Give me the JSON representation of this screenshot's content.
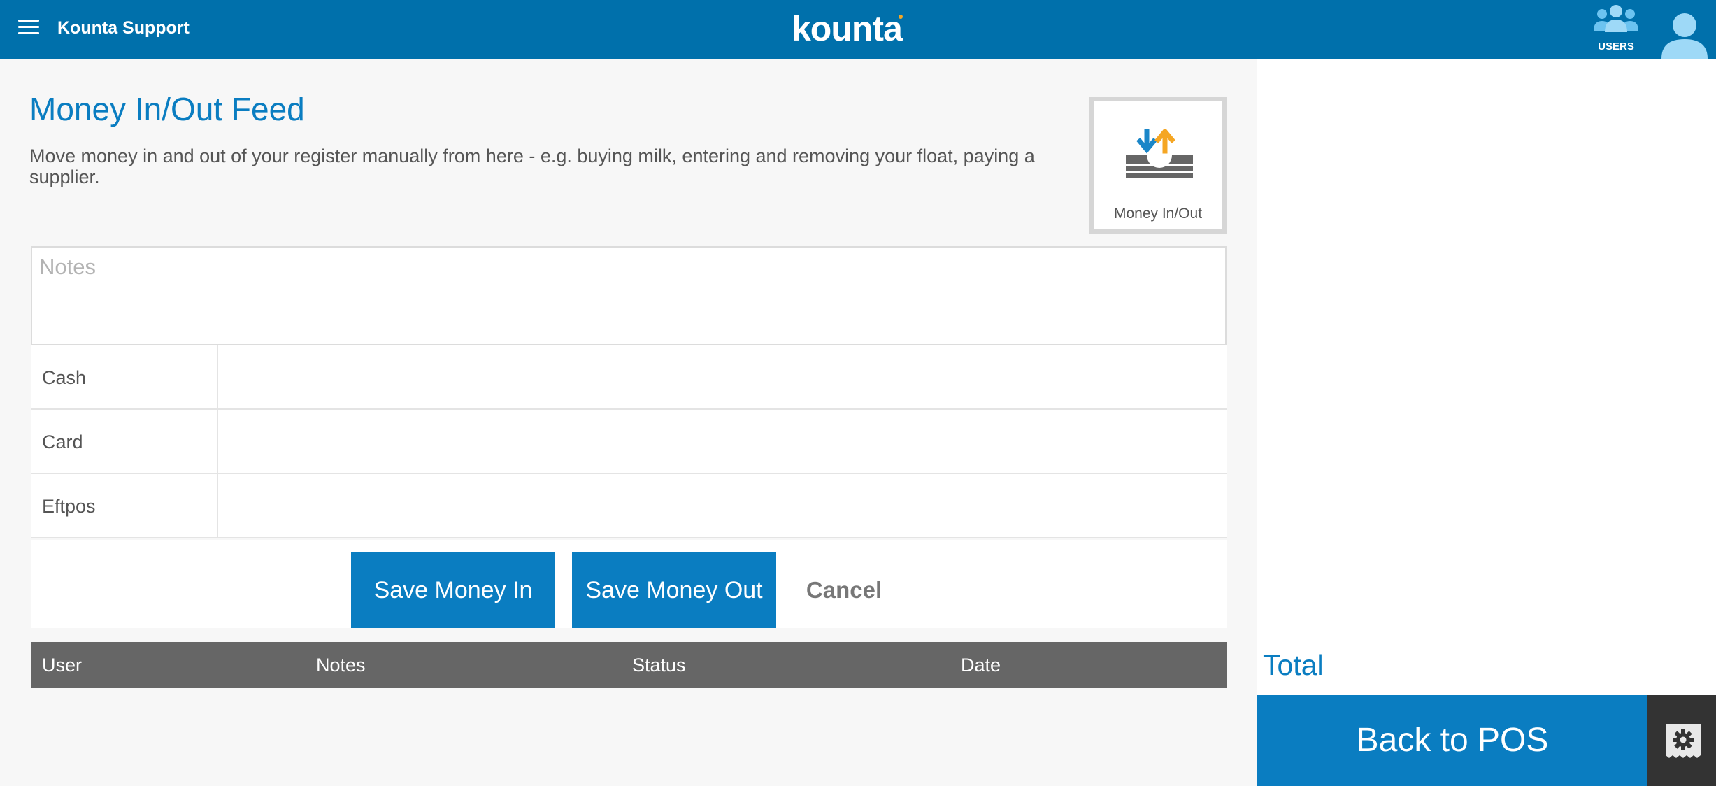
{
  "header": {
    "app_title": "Kounta Support",
    "logo_text": "kounta",
    "users_label": "USERS",
    "brand_color": "#0070ab"
  },
  "main": {
    "title": "Money In/Out Feed",
    "description": "Move money in and out of your register manually from here - e.g. buying milk, entering and removing your float, paying a supplier.",
    "tile_label": "Money In/Out",
    "notes_placeholder": "Notes",
    "payment_rows": [
      {
        "label": "Cash",
        "value": ""
      },
      {
        "label": "Card",
        "value": ""
      },
      {
        "label": "Eftpos",
        "value": ""
      }
    ],
    "buttons": {
      "save_in": "Save Money In",
      "save_out": "Save Money Out",
      "cancel": "Cancel"
    },
    "table_columns": [
      "User",
      "Notes",
      "Status",
      "Date"
    ]
  },
  "sidebar": {
    "total_label": "Total",
    "back_button": "Back to POS"
  },
  "icons": [
    "menu-icon",
    "users-icon",
    "avatar-icon",
    "money-in-out-icon",
    "gear-icon",
    "receipt-icon"
  ],
  "colors": {
    "accent": "#0a7dc1",
    "header": "#0070ab",
    "table_header": "#666666",
    "arrow_in": "#1a86c8",
    "arrow_out": "#f5a623"
  }
}
